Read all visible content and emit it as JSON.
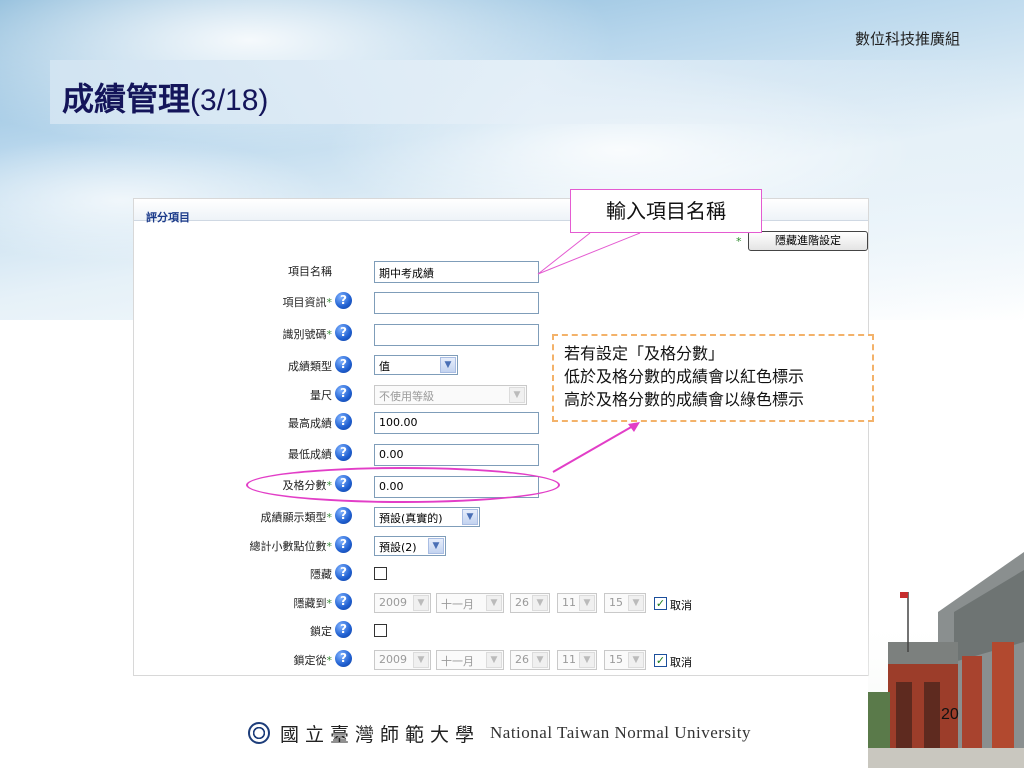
{
  "header": {
    "org": "數位科技推廣組",
    "title_zh": "成績管理",
    "title_num": "(3/18)"
  },
  "panel": {
    "section_title": "評分項目",
    "advanced_button": "隱藏進階設定",
    "fields": [
      {
        "label": "項目名稱",
        "required": false,
        "help": false,
        "value": "期中考成績"
      },
      {
        "label": "項目資訊",
        "required": true,
        "help": true,
        "value": ""
      },
      {
        "label": "識別號碼",
        "required": true,
        "help": true,
        "value": ""
      },
      {
        "label": "成績類型",
        "required": false,
        "help": true,
        "value": "值"
      },
      {
        "label": "量尺",
        "required": false,
        "help": true,
        "value": "不使用等級"
      },
      {
        "label": "最高成績",
        "required": false,
        "help": true,
        "value": "100.00"
      },
      {
        "label": "最低成績",
        "required": false,
        "help": true,
        "value": "0.00"
      },
      {
        "label": "及格分數",
        "required": true,
        "help": true,
        "value": "0.00"
      },
      {
        "label": "成績顯示類型",
        "required": true,
        "help": true,
        "value": "預設(真實的)"
      },
      {
        "label": "總計小數點位數",
        "required": true,
        "help": true,
        "value": "預設(2)"
      },
      {
        "label": "隱藏",
        "required": false,
        "help": true,
        "value": ""
      },
      {
        "label": "隱藏到",
        "required": true,
        "help": true,
        "value": ""
      },
      {
        "label": "鎖定",
        "required": false,
        "help": true,
        "value": ""
      },
      {
        "label": "鎖定從",
        "required": true,
        "help": true,
        "value": ""
      }
    ],
    "date_fields": {
      "year": "2009",
      "month": "十一月",
      "day": "26",
      "hour": "11",
      "minute": "15",
      "disable_label": "取消"
    }
  },
  "annotations": {
    "callout": "輸入項目名稱",
    "note_line1": "若有設定「及格分數」",
    "note_line2": "低於及格分數的成績會以紅色標示",
    "note_line3": "高於及格分數的成績會以綠色標示"
  },
  "footer": {
    "university_zh": "國立臺灣師範大學",
    "university_en": "National Taiwan Normal University",
    "page_number": "20"
  },
  "colors": {
    "title": "#14155a",
    "annotation_magenta": "#e23ec7",
    "note_border": "#f3b26a",
    "help_icon": "#1f5fd0"
  }
}
